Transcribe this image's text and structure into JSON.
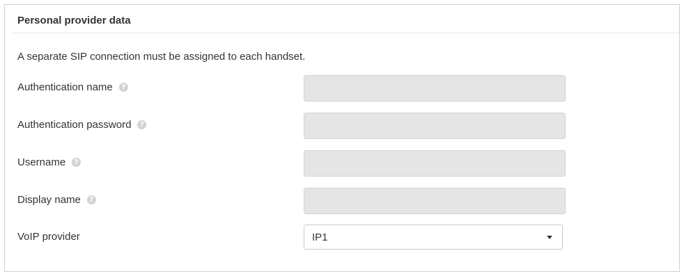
{
  "panel": {
    "title": "Personal provider data",
    "intro": "A separate SIP connection must be assigned to each handset."
  },
  "fields": [
    {
      "label": "Authentication name",
      "value": "",
      "has_help": true,
      "help_icon": "help-circle-icon"
    },
    {
      "label": "Authentication password",
      "value": "",
      "has_help": true,
      "help_icon": "help-circle-icon"
    },
    {
      "label": "Username",
      "value": "",
      "has_help": true,
      "help_icon": "help-circle-icon"
    },
    {
      "label": "Display name",
      "value": "",
      "has_help": true,
      "help_icon": "help-circle-icon"
    }
  ],
  "voip": {
    "label": "VoIP provider",
    "selected": "IP1",
    "dropdown_icon": "caret-down-icon"
  },
  "help_glyph": "?",
  "colors": {
    "border": "#cfcfcf",
    "disabled_field_bg": "#e5e5e5",
    "text": "#333333",
    "help_icon": "#d3d3d3"
  }
}
